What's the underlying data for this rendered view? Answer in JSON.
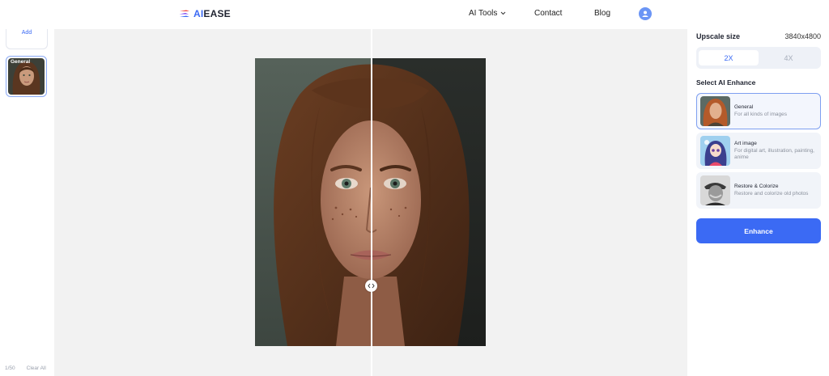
{
  "header": {
    "logo_ai": "AI",
    "logo_rest": "EASE",
    "nav_tools": "AI Tools",
    "nav_contact": "Contact",
    "nav_blog": "Blog"
  },
  "sidebar": {
    "add_label": "Add",
    "thumb_label": "General",
    "page_count": "1/50",
    "clear_label": "Clear All"
  },
  "panel": {
    "upscale_label": "Upscale size",
    "upscale_value": "3840x4800",
    "scale_options": [
      "2X",
      "4X"
    ],
    "selected_scale": "2X",
    "enhance_title": "Select AI Enhance",
    "options": [
      {
        "name": "General",
        "desc": "For all kinds of images"
      },
      {
        "name": "Art image",
        "desc": "For digital art, illustration, painting, anime"
      },
      {
        "name": "Restore & Colorize",
        "desc": "Restore and colorize old photos"
      }
    ],
    "enhance_button": "Enhance"
  },
  "colors": {
    "accent": "#3b6af4",
    "canvas_bg": "#f2f2f2",
    "option_bg": "#f1f4f9"
  }
}
